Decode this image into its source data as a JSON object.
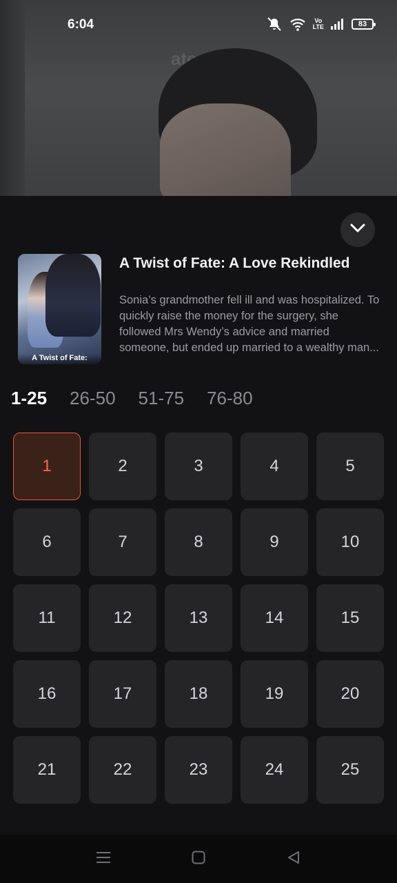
{
  "status_bar": {
    "time": "6:04",
    "volte": "Vo\nLTE",
    "battery": "83"
  },
  "background": {
    "ghost_title": "ate: A"
  },
  "show": {
    "title": "A Twist of Fate: A Love Rekindled",
    "description": "Sonia’s grandmother fell ill and was hospitalized. To quickly raise the money for the surgery, she followed Mrs Wendy’s advice and married someone, but ended up married to a wealthy man...",
    "poster_caption": "A Twist of Fate:"
  },
  "range_tabs": [
    {
      "label": "1-25",
      "active": true
    },
    {
      "label": "26-50",
      "active": false
    },
    {
      "label": "51-75",
      "active": false
    },
    {
      "label": "76-80",
      "active": false
    }
  ],
  "episodes": [
    "1",
    "2",
    "3",
    "4",
    "5",
    "6",
    "7",
    "8",
    "9",
    "10",
    "11",
    "12",
    "13",
    "14",
    "15",
    "16",
    "17",
    "18",
    "19",
    "20",
    "21",
    "22",
    "23",
    "24",
    "25"
  ],
  "selected_episode": "1",
  "colors": {
    "accent": "#ff6a45",
    "sheet_bg": "#121214",
    "tile_bg": "#252528"
  },
  "icons": {
    "collapse": "chevron-down-icon",
    "nav_menu": "menu-icon",
    "nav_home": "home-square-icon",
    "nav_back": "back-triangle-icon"
  }
}
